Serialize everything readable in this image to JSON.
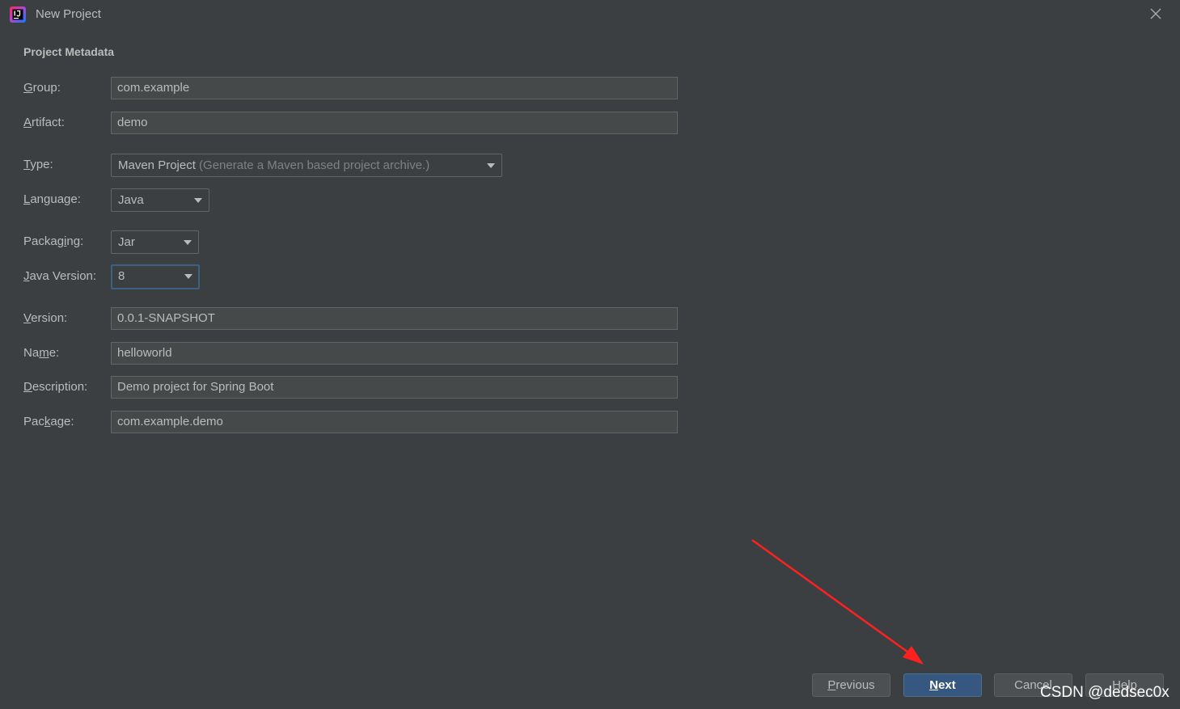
{
  "window": {
    "title": "New Project",
    "app_icon": "intellij-idea-icon",
    "close_icon": "close-icon"
  },
  "section_title": "Project Metadata",
  "fields": {
    "group": {
      "label_mnemonic": "G",
      "label_rest": "roup:",
      "value": "com.example"
    },
    "artifact": {
      "label_mnemonic": "A",
      "label_rest": "rtifact:",
      "value": "demo"
    },
    "version": {
      "label_mnemonic": "V",
      "label_rest": "ersion:",
      "value": "0.0.1-SNAPSHOT"
    },
    "name": {
      "label_pre": "Na",
      "label_mnemonic": "m",
      "label_rest": "e:",
      "value": "helloworld"
    },
    "description": {
      "label_mnemonic": "D",
      "label_rest": "escription:",
      "value": "Demo project for Spring Boot"
    },
    "package": {
      "label_pre": "Pac",
      "label_mnemonic": "k",
      "label_rest": "age:",
      "value": "com.example.demo"
    }
  },
  "combos": {
    "type": {
      "label_mnemonic": "T",
      "label_rest": "ype:",
      "value": "Maven Project",
      "hint": "(Generate a Maven based project archive.)"
    },
    "language": {
      "label_mnemonic": "L",
      "label_rest": "anguage:",
      "value": "Java"
    },
    "packaging": {
      "label_pre": "Packag",
      "label_mnemonic": "i",
      "label_rest": "ng:",
      "value": "Jar"
    },
    "java_version": {
      "label_mnemonic": "J",
      "label_rest": "ava Version:",
      "value": "8"
    }
  },
  "buttons": {
    "previous": {
      "mnemonic": "P",
      "rest": "revious"
    },
    "next": {
      "mnemonic": "N",
      "rest": "ext"
    },
    "cancel": {
      "label": "Cancel"
    },
    "help": {
      "label": "Help"
    }
  },
  "watermark": "CSDN @dedsec0x",
  "colors": {
    "background": "#3c3f41",
    "field_background": "#45494a",
    "default_button": "#365880",
    "focus_border": "#3d6185",
    "annotation_arrow": "#ff2020"
  }
}
